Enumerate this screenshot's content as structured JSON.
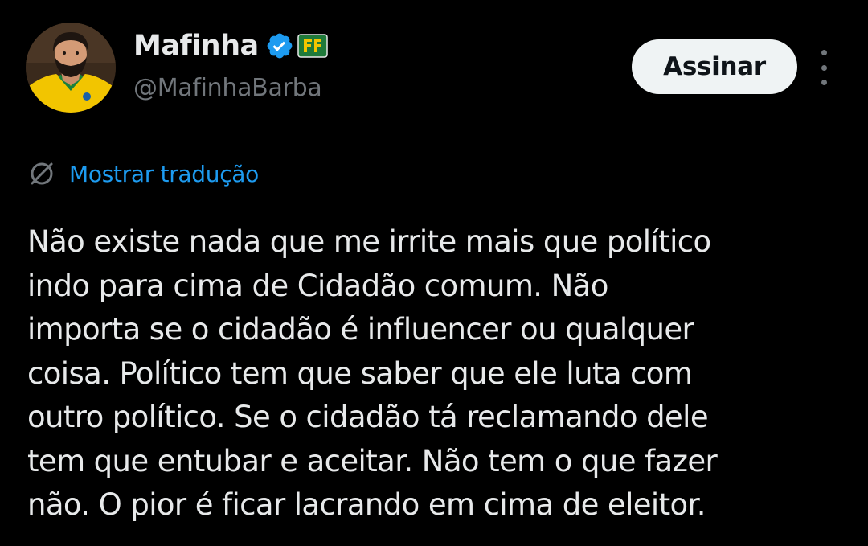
{
  "author": {
    "display_name": "Mafinha",
    "handle": "@MafinhaBarba",
    "avatar_icon": "profile-photo",
    "verified_icon": "verified-badge-icon",
    "affiliate_badge_icon": "affiliate-badge-icon"
  },
  "actions": {
    "subscribe_label": "Assinar",
    "more_icon": "more-options-icon"
  },
  "translation": {
    "icon": "globe-icon",
    "label": "Mostrar tradução"
  },
  "tweet": {
    "lines": [
      "Não existe nada que me irrite mais que político",
      "indo para cima de Cidadão comum. Não",
      "importa se o cidadão é influencer ou qualquer",
      "coisa. Político tem que saber que ele luta com",
      "outro político. Se o cidadão tá reclamando dele",
      "tem que entubar e aceitar. Não tem o que fazer",
      "não. O pior é ficar lacrando em cima de eleitor."
    ]
  },
  "colors": {
    "background": "#000000",
    "text_primary": "#e7e9ea",
    "text_secondary": "#71767b",
    "link": "#1d9bf0",
    "verified": "#1d9bf0",
    "button_bg": "#eff3f4",
    "button_text": "#0f1419"
  }
}
